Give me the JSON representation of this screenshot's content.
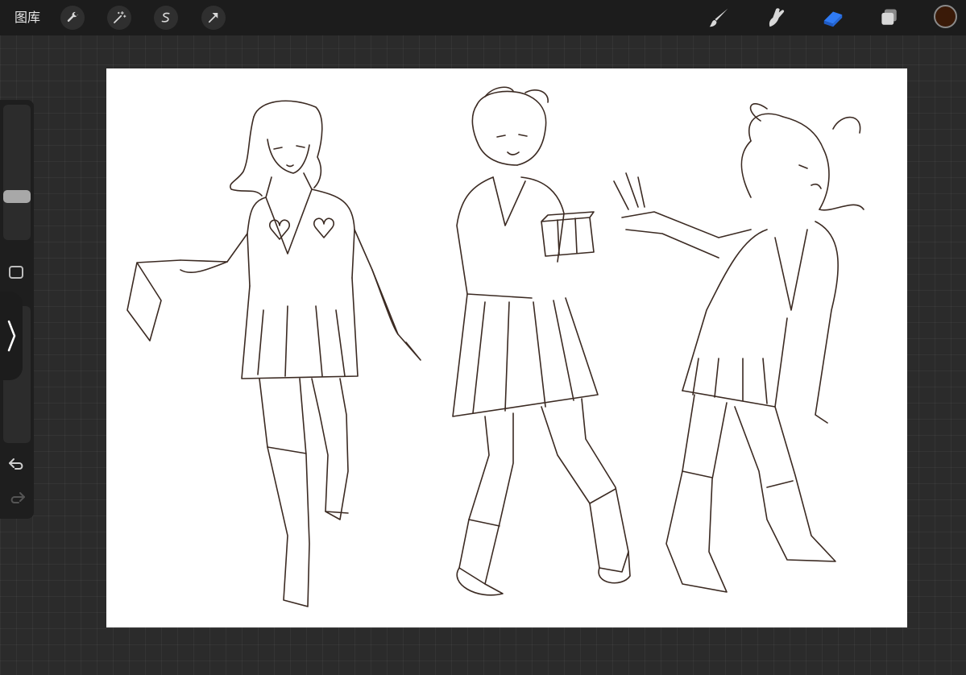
{
  "app": {
    "gallery_label": "图库"
  },
  "toolbar": {
    "left_tools": [
      {
        "name": "actions",
        "icon": "wrench-icon"
      },
      {
        "name": "adjustments",
        "icon": "magic-wand-icon"
      },
      {
        "name": "selection",
        "icon": "selection-s-icon"
      },
      {
        "name": "transform",
        "icon": "arrow-cursor-icon"
      }
    ],
    "right_tools": [
      {
        "name": "brush",
        "icon": "brush-icon",
        "active": false
      },
      {
        "name": "smudge",
        "icon": "smudge-icon",
        "active": false
      },
      {
        "name": "eraser",
        "icon": "eraser-icon",
        "active": true
      },
      {
        "name": "layers",
        "icon": "layers-icon",
        "active": false
      }
    ],
    "active_color": "#3a1a08",
    "accent_color": "#2f7bf5"
  },
  "sidebar": {
    "brush_size_slider": "brush-size",
    "opacity_slider": "brush-opacity",
    "undo_icon": "undo-icon",
    "redo_icon": "redo-icon"
  },
  "canvas": {
    "background": "#ffffff",
    "stroke_color": "#3b2a22",
    "content": "sketch-of-three-figures"
  }
}
